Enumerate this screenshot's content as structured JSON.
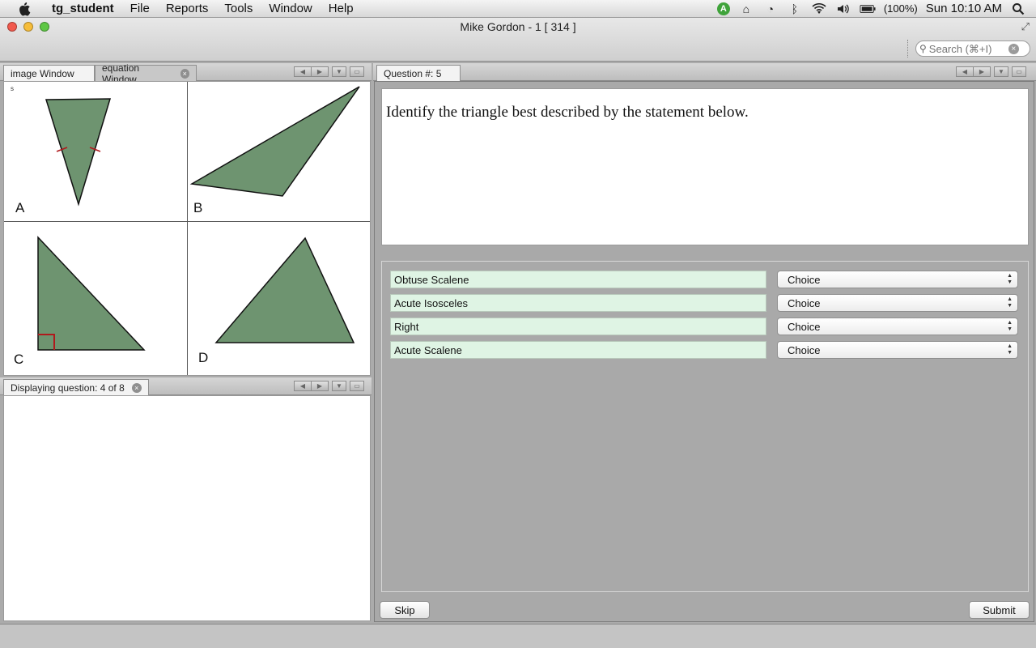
{
  "menubar": {
    "app_name": "tg_student",
    "items": [
      "File",
      "Reports",
      "Tools",
      "Window",
      "Help"
    ],
    "battery": "(100%)",
    "clock": "Sun 10:10 AM"
  },
  "window": {
    "title": "Mike Gordon - 1 [ 314 ]",
    "search_placeholder": "Search (⌘+I)"
  },
  "image_panel": {
    "tabs": [
      {
        "label": "image Window"
      },
      {
        "label": "equation Window"
      }
    ],
    "corner_mark": "s",
    "triangles": [
      {
        "letter": "A",
        "color": "#6e9470"
      },
      {
        "letter": "B",
        "color": "#6e9470"
      },
      {
        "letter": "C",
        "color": "#6e9470"
      },
      {
        "letter": "D",
        "color": "#6e9470"
      }
    ]
  },
  "status_panel": {
    "tab_label": "Displaying question: 4 of 8"
  },
  "question_panel": {
    "tab_label": "Question #: 5",
    "question_text": "Identify the triangle best described by the statement below.",
    "answers": [
      {
        "label": "Obtuse Scalene",
        "choice": "Choice"
      },
      {
        "label": "Acute Isosceles",
        "choice": "Choice"
      },
      {
        "label": "Right",
        "choice": "Choice"
      },
      {
        "label": "Acute Scalene",
        "choice": "Choice"
      }
    ],
    "skip_label": "Skip",
    "submit_label": "Submit"
  },
  "colors": {
    "triangle_fill": "#6e9470",
    "answer_field": "#dff4e4",
    "marker_red": "#b0191c"
  }
}
